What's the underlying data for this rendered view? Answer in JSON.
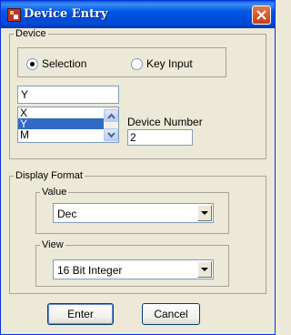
{
  "window": {
    "title": "Device Entry"
  },
  "device": {
    "legend": "Device",
    "radio_selection": "Selection",
    "radio_keyinput": "Key Input",
    "device_text": "Y",
    "list_items": [
      "X",
      "Y",
      "M"
    ],
    "selected_item": "Y",
    "device_number_label": "Device Number",
    "device_number_value": "2"
  },
  "display_format": {
    "legend": "Display Format",
    "value_legend": "Value",
    "value_selected": "Dec",
    "view_legend": "View",
    "view_selected": "16 Bit Integer"
  },
  "buttons": {
    "enter": "Enter",
    "cancel": "Cancel"
  },
  "colors": {
    "title_bar": "#0055e5",
    "selection": "#316ac5",
    "dialog_bg": "#ece9d8"
  },
  "icons": {
    "app": "device-app-icon",
    "close": "close-icon"
  }
}
